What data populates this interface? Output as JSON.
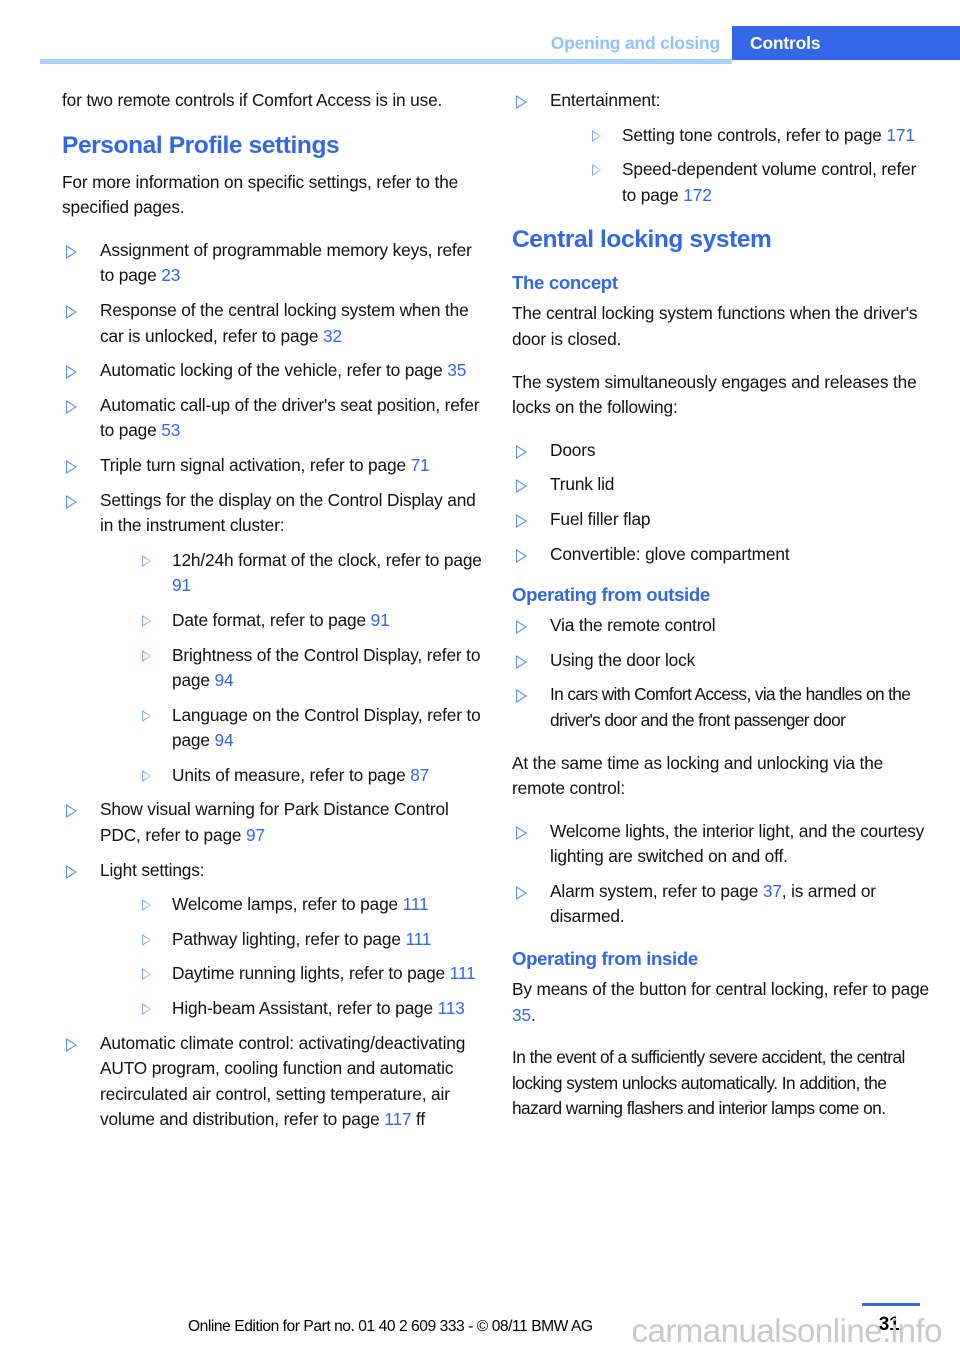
{
  "header": {
    "chapter": "Opening and closing",
    "section_tab": "Controls",
    "accent_color": "#3367E8",
    "chapter_color": "#8FC2FC",
    "rule_color": "#A9D2FB"
  },
  "left_column": {
    "intro": "for two remote controls if Comfort Access is in use.",
    "heading_personal_profile": "Personal Profile settings",
    "personal_profile_intro": "For more information on specific settings, refer to the specified pages.",
    "items": [
      {
        "text": "Assignment of programmable memory keys, refer to page ",
        "page": "23"
      },
      {
        "text": "Response of the central locking system when the car is unlocked, refer to page ",
        "page": "32"
      },
      {
        "text": "Automatic locking of the vehicle, refer to page ",
        "page": "35"
      },
      {
        "text": "Automatic call-up of the driver's seat position, refer to page ",
        "page": "53"
      },
      {
        "text": "Triple turn signal activation, refer to page ",
        "page": "71"
      }
    ],
    "display_settings": {
      "label": "Settings for the display on the Control Display and in the instrument cluster:",
      "sub_items": [
        {
          "text": "12h/24h format of the clock, refer to page ",
          "page": "91"
        },
        {
          "text": "Date format, refer to page ",
          "page": "91"
        },
        {
          "text": "Brightness of the Control Display, refer to page ",
          "page": "94"
        },
        {
          "text": "Language on the Control Display, refer to page ",
          "page": "94"
        },
        {
          "text": "Units of measure, refer to page ",
          "page": "87"
        }
      ]
    },
    "pdc_item": {
      "text": "Show visual warning for Park Distance Control PDC, refer to page ",
      "page": "97"
    },
    "light_settings": {
      "label": "Light settings:",
      "sub_items": [
        {
          "text": "Welcome lamps, refer to page ",
          "page": "111"
        },
        {
          "text": "Pathway lighting, refer to page ",
          "page": "111"
        },
        {
          "text": "Daytime running lights, refer to page ",
          "page": "111"
        },
        {
          "text": "High-beam Assistant, refer to page ",
          "page": "113"
        }
      ]
    },
    "climate_item": {
      "text": "Automatic climate control: activating/deactivating AUTO program, cooling function and automatic recirculated air control, setting temperature, air volume and distribution, refer to page ",
      "page": "117",
      "suffix": " ff"
    }
  },
  "right_column": {
    "entertainment": {
      "label": "Entertainment:",
      "sub_items": [
        {
          "text": "Setting tone controls, refer to page ",
          "page": "171"
        },
        {
          "text": "Speed-dependent volume control, refer to page ",
          "page": "172"
        }
      ]
    },
    "heading_central_locking": "Central locking system",
    "heading_the_concept": "The concept",
    "concept_para_1": "The central locking system functions when the driver's door is closed.",
    "concept_para_2": "The system simultaneously engages and releases the locks on the following:",
    "concept_items": [
      "Doors",
      "Trunk lid",
      "Fuel filler flap",
      "Convertible: glove compartment"
    ],
    "heading_operating_outside": "Operating from outside",
    "outside_items": [
      "Via the remote control",
      "Using the door lock",
      "In cars with Comfort Access, via the handles on the driver's door and the front passenger door"
    ],
    "outside_para": "At the same time as locking and unlocking via the remote control:",
    "outside_effects": [
      {
        "prefix": "Welcome lights, the interior light, and the courtesy lighting are switched on and off.",
        "page": "",
        "suffix": ""
      },
      {
        "prefix": "Alarm system, refer to page ",
        "page": "37",
        "suffix": ", is armed or disarmed."
      }
    ],
    "heading_operating_inside": "Operating from inside",
    "inside_para_1_prefix": "By means of the button for central locking, refer to page ",
    "inside_para_1_page": "35",
    "inside_para_1_suffix": ".",
    "inside_para_2": "In the event of a sufficiently severe accident, the central locking system unlocks automatically. In addition, the hazard warning flashers and interior lamps come on."
  },
  "footer": {
    "note": "Online Edition for Part no. 01 40 2 609 333 - © 08/11 BMW AG",
    "page_number": "31",
    "watermark": "carmanualsonline.info"
  }
}
